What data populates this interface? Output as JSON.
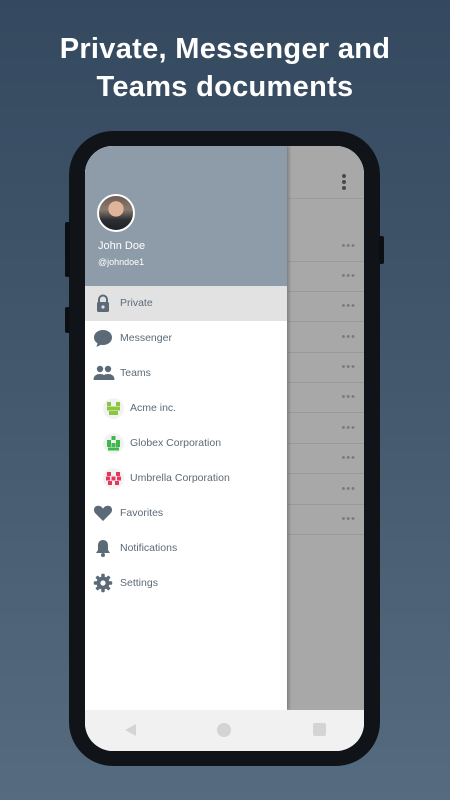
{
  "headline": {
    "line1": "Private, Messenger and",
    "line2": "Teams documents"
  },
  "drawer": {
    "user": {
      "name": "John Doe",
      "handle": "@johndoe1"
    },
    "items": [
      {
        "label": "Private",
        "icon": "lock-icon",
        "active": true
      },
      {
        "label": "Messenger",
        "icon": "chat-bubble-icon"
      },
      {
        "label": "Teams",
        "icon": "people-icon"
      },
      {
        "label": "Favorites",
        "icon": "heart-icon"
      },
      {
        "label": "Notifications",
        "icon": "bell-icon"
      },
      {
        "label": "Settings",
        "icon": "gear-icon"
      }
    ],
    "teams": [
      {
        "label": "Acme inc.",
        "color": "#8cc63f"
      },
      {
        "label": "Globex Corporation",
        "color": "#3db84a"
      },
      {
        "label": "Umbrella Corporation",
        "color": "#e8365a"
      }
    ]
  },
  "colors": {
    "header": "#8d9ca8",
    "icon": "#5c6a78",
    "active_bg": "#e2e2e2",
    "background_app": "#a8a8a8"
  },
  "system_nav": {
    "back": "back-icon",
    "home": "home-icon",
    "recents": "recents-icon"
  }
}
